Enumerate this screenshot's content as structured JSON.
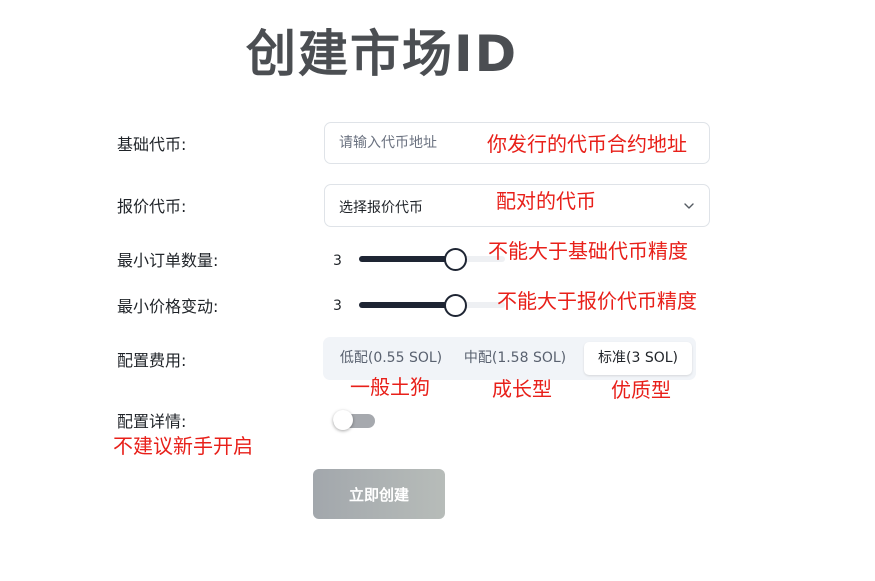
{
  "page": {
    "title": "创建市场ID"
  },
  "form": {
    "base_token": {
      "label": "基础代币:",
      "placeholder": "请输入代币地址",
      "value": ""
    },
    "quote_token": {
      "label": "报价代币:",
      "selected": "选择报价代币"
    },
    "min_order_size": {
      "label": "最小订单数量:",
      "value": "3",
      "fill_fraction": 0.66
    },
    "min_price_tick": {
      "label": "最小价格变动:",
      "value": "3",
      "fill_fraction": 0.66
    },
    "fee_config": {
      "label": "配置费用:",
      "options": [
        "低配(0.55 SOL)",
        "中配(1.58 SOL)",
        "标准(3 SOL)"
      ],
      "selected_index": 2
    },
    "config_details": {
      "label": "配置详情:",
      "enabled": false
    },
    "submit_label": "立即创建"
  },
  "annotations": {
    "base_token": "你发行的代币合约地址",
    "quote_token": "配对的代币",
    "min_order_size": "不能大于基础代币精度",
    "min_price_tick": "不能大于报价代币精度",
    "fee_low": "一般土狗",
    "fee_mid": "成长型",
    "fee_standard": "优质型",
    "config_details": "不建议新手开启"
  },
  "colors": {
    "annotation": "#e8201a",
    "slider_fill": "#1e2533",
    "title": "#4b4e52",
    "button": "#a2a7ac"
  }
}
